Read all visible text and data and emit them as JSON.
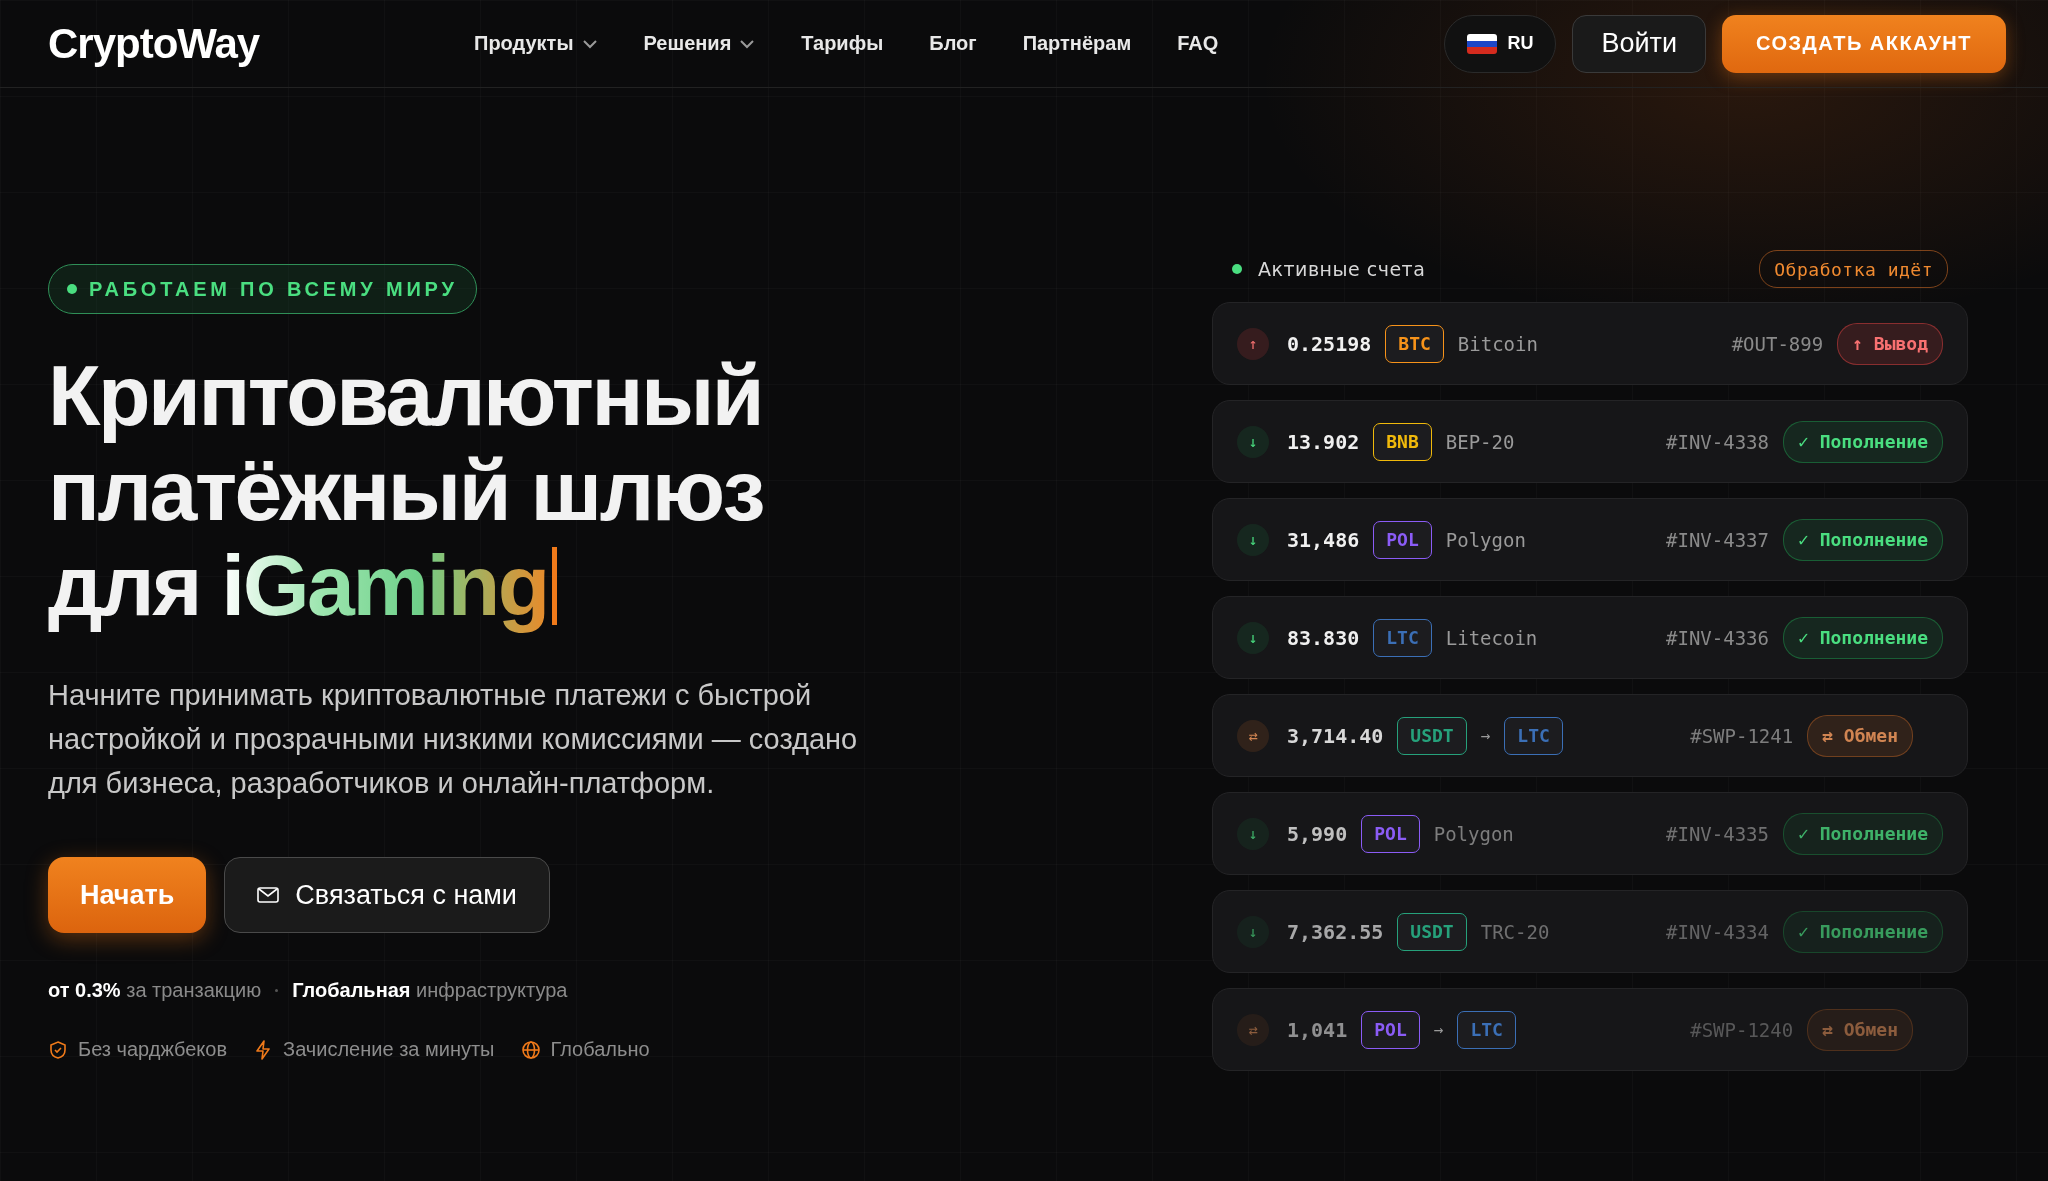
{
  "header": {
    "logo": "CryptoWay",
    "nav": [
      {
        "label": "Продукты",
        "dropdown": true
      },
      {
        "label": "Решения",
        "dropdown": true
      },
      {
        "label": "Тарифы",
        "dropdown": false
      },
      {
        "label": "Блог",
        "dropdown": false
      },
      {
        "label": "Партнёрам",
        "dropdown": false
      },
      {
        "label": "FAQ",
        "dropdown": false
      }
    ],
    "language": "RU",
    "login": "Войти",
    "signup": "СОЗДАТЬ АККАУНТ"
  },
  "hero": {
    "badge": "РАБОТАЕМ ПО ВСЕМУ МИРУ",
    "title_lines": [
      "Криптовалютный",
      "платёжный шлюз",
      "для"
    ],
    "title_highlight": "iGaming",
    "description": "Начните принимать криптовалютные платежи с быстрой настройкой и прозрачными низкими комиссиями — создано для бизнеса, разработчиков и онлайн-платформ.",
    "primary_button": "Начать",
    "secondary_button": "Связаться с нами",
    "stats": [
      "**от 0.3%** за транзакцию",
      "**Глобальная** инфраструктура"
    ],
    "features": [
      {
        "kind": "shield",
        "label": "Без чарджбеков"
      },
      {
        "kind": "bolt",
        "label": "Зачисление за минуты"
      },
      {
        "kind": "globe",
        "label": "Глобально"
      }
    ]
  },
  "feed": {
    "title": "Активные счета",
    "status": "Обработка идёт",
    "rows": [
      {
        "kind": "out",
        "icon": "↑",
        "amount": "0.25198",
        "tokens": [
          {
            "label": "BTC",
            "color": "#f7931a"
          }
        ],
        "network": "Bitcoin",
        "id": "#OUT-899",
        "status": "↑ Вывод"
      },
      {
        "kind": "in",
        "icon": "↓",
        "amount": "13.902",
        "tokens": [
          {
            "label": "BNB",
            "color": "#f0b90b"
          }
        ],
        "network": "BEP-20",
        "id": "#INV-4338",
        "status": "✓ Пополнение"
      },
      {
        "kind": "in",
        "icon": "↓",
        "amount": "31,486",
        "tokens": [
          {
            "label": "POL",
            "color": "#8b5cf6"
          }
        ],
        "network": "Polygon",
        "id": "#INV-4337",
        "status": "✓ Пополнение"
      },
      {
        "kind": "in",
        "icon": "↓",
        "amount": "83.830",
        "tokens": [
          {
            "label": "LTC",
            "color": "#3b6fb6"
          }
        ],
        "network": "Litecoin",
        "id": "#INV-4336",
        "status": "✓ Пополнение"
      },
      {
        "kind": "swap",
        "icon": "⇄",
        "amount": "3,714.40",
        "tokens": [
          {
            "label": "USDT",
            "color": "#26a17b"
          },
          {
            "label": "LTC",
            "color": "#3b6fb6"
          }
        ],
        "arrow": "→",
        "id": "#SWP-1241",
        "status": "⇄ Обмен"
      },
      {
        "kind": "in",
        "icon": "↓",
        "amount": "5,990",
        "tokens": [
          {
            "label": "POL",
            "color": "#8b5cf6"
          }
        ],
        "network": "Polygon",
        "id": "#INV-4335",
        "status": "✓ Пополнение"
      },
      {
        "kind": "in",
        "icon": "↓",
        "amount": "7,362.55",
        "tokens": [
          {
            "label": "USDT",
            "color": "#26a17b"
          }
        ],
        "network": "TRC-20",
        "id": "#INV-4334",
        "status": "✓ Пополнение"
      },
      {
        "kind": "swap",
        "icon": "⇄",
        "amount": "1,041",
        "tokens": [
          {
            "label": "POL",
            "color": "#8b5cf6"
          },
          {
            "label": "LTC",
            "color": "#3b6fb6"
          }
        ],
        "arrow": "→",
        "id": "#SWP-1240",
        "status": "⇄ Обмен"
      }
    ]
  }
}
